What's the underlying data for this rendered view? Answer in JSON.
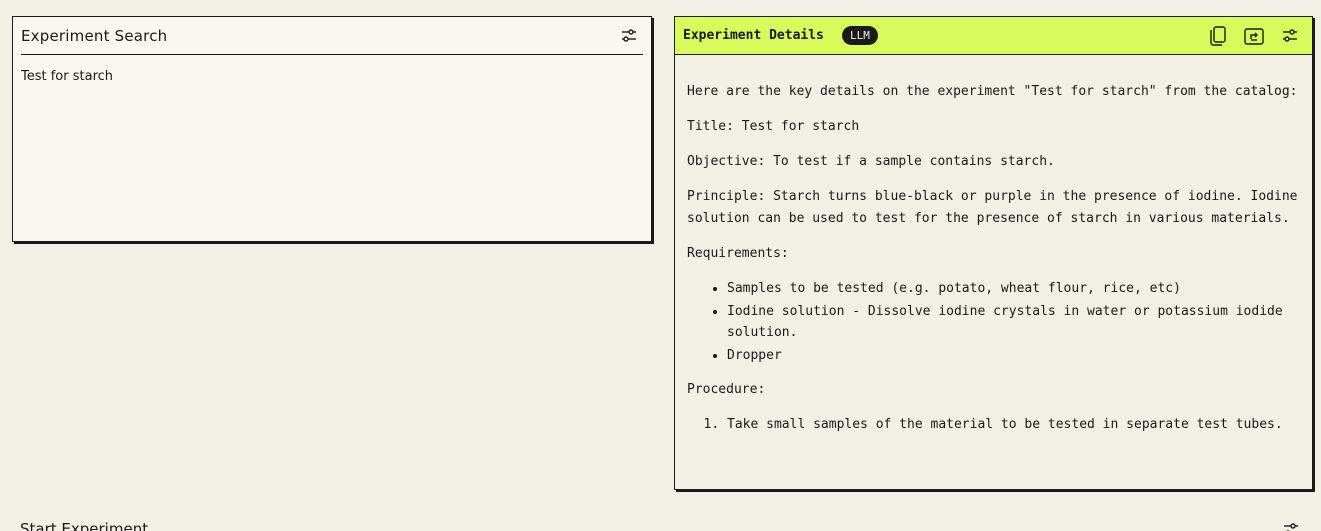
{
  "search_panel": {
    "title": "Experiment Search",
    "query": "Test for starch"
  },
  "details_panel": {
    "title": "Experiment Details",
    "badge": "LLM",
    "intro": "Here are the key details on the experiment \"Test for starch\" from the catalog:",
    "title_line": "Title: Test for starch",
    "objective": "Objective: To test if a sample contains starch.",
    "principle": "Principle: Starch turns blue-black or purple in the presence of iodine. Iodine solution can be used to test for the presence of starch in various materials.",
    "requirements_heading": "Requirements:",
    "requirements": [
      "Samples to be tested (e.g. potato, wheat flour, rice, etc)",
      "Iodine solution - Dissolve iodine crystals in water or potassium iodide solution.",
      "Dropper"
    ],
    "procedure_heading": "Procedure:",
    "procedure": [
      "Take small samples of the material to be tested in separate test tubes."
    ]
  },
  "start_panel": {
    "title": "Start Experiment"
  },
  "icons": {
    "settings": "sliders-icon",
    "copy": "copy-icon",
    "export": "export-icon"
  },
  "colors": {
    "background": "#f2efe4",
    "accent": "#d8fa5a",
    "ink": "#1a1a1a"
  }
}
